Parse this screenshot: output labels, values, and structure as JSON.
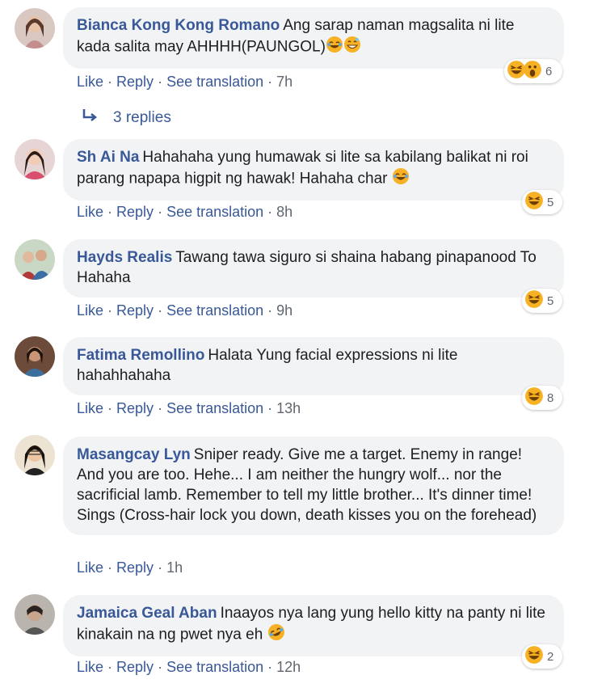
{
  "actions": {
    "like": "Like",
    "reply": "Reply",
    "translate": "See translation",
    "dot": "·"
  },
  "colors": {
    "link": "#385898",
    "bubble": "#f2f3f5",
    "meta": "#606770",
    "haha": "#f7b125"
  },
  "replies_label": "3 replies",
  "comments": [
    {
      "author": "Bianca Kong Kong Romano",
      "text": "Ang sarap naman magsalita ni lite kada salita may AHHHH(PAUNGOL)",
      "trailing_icons": [
        "joy-emoji-icon",
        "smile-emoji-icon"
      ],
      "time": "7h",
      "reaction_icons": [
        "haha-reaction-icon",
        "wow-reaction-icon"
      ],
      "reaction_count": "6",
      "translation": true
    },
    {
      "author": "Sh Ai Na",
      "text": "Hahahaha yung humawak si lite sa kabilang balikat ni roi parang napapa higpit ng hawak! Hahaha char",
      "trailing_icons": [
        "joy-emoji-icon"
      ],
      "time": "8h",
      "reaction_icons": [
        "haha-reaction-icon"
      ],
      "reaction_count": "5",
      "translation": true
    },
    {
      "author": "Hayds Realis",
      "text": "Tawang tawa siguro si shaina habang pinapanood To Hahaha",
      "trailing_icons": [],
      "time": "9h",
      "reaction_icons": [
        "haha-reaction-icon"
      ],
      "reaction_count": "5",
      "translation": true
    },
    {
      "author": "Fatima Remollino",
      "text": "Halata Yung facial expressions ni lite hahahhahaha",
      "trailing_icons": [],
      "time": "13h",
      "reaction_icons": [
        "haha-reaction-icon"
      ],
      "reaction_count": "8",
      "translation": true
    },
    {
      "author": "Masangcay Lyn",
      "text": "Sniper ready. Give me a target. Enemy in range! And you are too. Hehe... I am neither the hungry wolf... nor the sacrificial lamb. Remember to tell my little brother... It's dinner time! Sings (Cross-hair lock you down, death kisses you on the forehead)",
      "trailing_icons": [],
      "time": "1h",
      "reaction_icons": [],
      "reaction_count": "",
      "translation": false
    },
    {
      "author": "Jamaica Geal Aban",
      "text": "Inaayos nya lang yung hello kitty na panty ni lite kinakain na ng pwet nya eh",
      "trailing_icons": [
        "rofl-emoji-icon"
      ],
      "time": "12h",
      "reaction_icons": [
        "haha-reaction-icon"
      ],
      "reaction_count": "2",
      "translation": true
    }
  ]
}
